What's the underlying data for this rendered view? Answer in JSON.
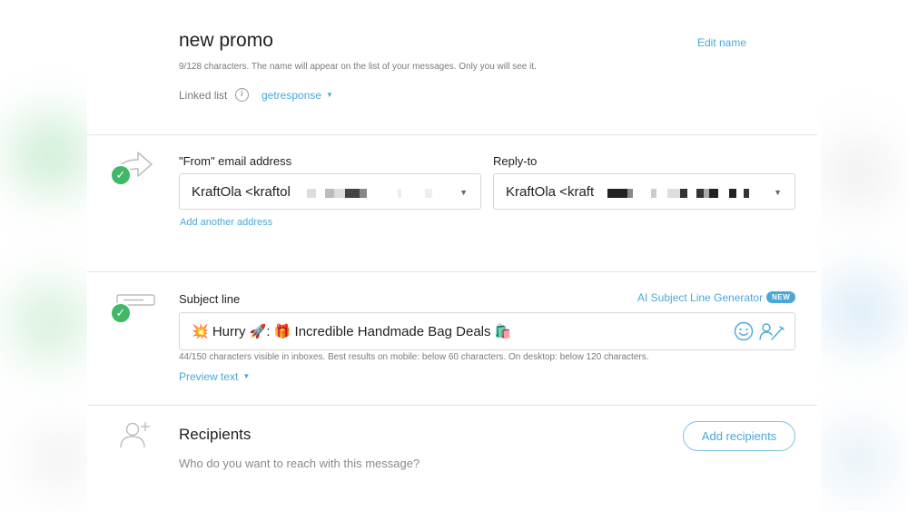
{
  "header": {
    "title": "new promo",
    "edit_label": "Edit name",
    "name_hint": "9/128 characters. The name will appear on the list of your messages. Only you will see it.",
    "linked_list_label": "Linked list",
    "linked_list_value": "getresponse"
  },
  "from": {
    "label": "\"From\" email address",
    "value": "KraftOla <kraftol",
    "add_another": "Add another address"
  },
  "reply_to": {
    "label": "Reply-to",
    "value": "KraftOla <kraft"
  },
  "subject": {
    "label": "Subject line",
    "ai_generator": "AI Subject Line Generator",
    "ai_badge": "NEW",
    "value": "💥 Hurry 🚀: 🎁 Incredible Handmade Bag Deals 🛍️",
    "hint": "44/150 characters visible in inboxes. Best results on mobile: below 60 characters. On desktop: below 120 characters.",
    "preview_text": "Preview text"
  },
  "recipients": {
    "title": "Recipients",
    "question": "Who do you want to reach with this message?",
    "add_button": "Add recipients"
  },
  "colors": {
    "accent": "#4aa8d8",
    "success": "#3fb868",
    "divider": "#e3e3e3"
  },
  "icons": {
    "info": "info-icon",
    "forward": "forward-arrow-icon",
    "subject": "subject-line-icon",
    "emoji": "emoji-icon",
    "personalize": "personalize-icon",
    "add_user": "add-user-icon",
    "check": "check-icon"
  }
}
